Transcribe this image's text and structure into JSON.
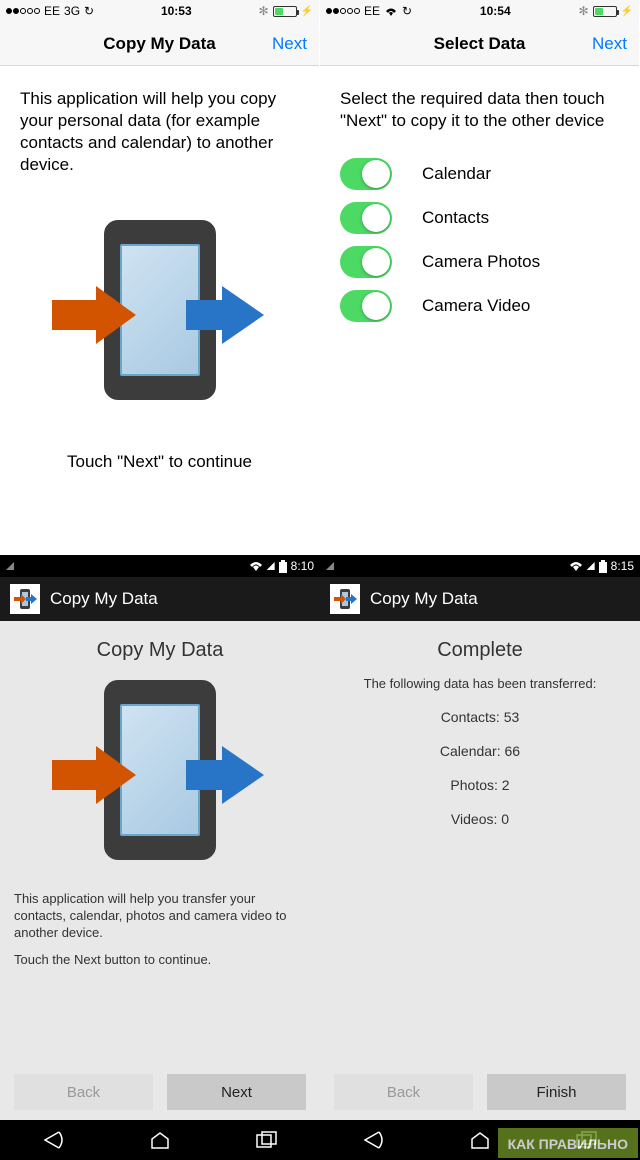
{
  "ios_left": {
    "status": {
      "carrier": "EE",
      "net": "3G",
      "time": "10:53"
    },
    "nav": {
      "title": "Copy My Data",
      "next": "Next"
    },
    "intro": "This application will help you copy your personal data (for example contacts and calendar) to another device.",
    "hint": "Touch \"Next\" to continue"
  },
  "ios_right": {
    "status": {
      "carrier": "EE",
      "time": "10:54"
    },
    "nav": {
      "title": "Select Data",
      "next": "Next"
    },
    "prompt": "Select the required data then touch \"Next\" to copy it to the other device",
    "items": [
      {
        "label": "Calendar",
        "on": true
      },
      {
        "label": "Contacts",
        "on": true
      },
      {
        "label": "Camera Photos",
        "on": true
      },
      {
        "label": "Camera Video",
        "on": true
      }
    ]
  },
  "and_left": {
    "status": {
      "time": "8:10"
    },
    "appbar": "Copy My Data",
    "heading": "Copy My Data",
    "desc1": "This application will help you transfer your contacts, calendar, photos and camera video to another device.",
    "desc2": "Touch the Next button to continue.",
    "btn_back": "Back",
    "btn_next": "Next"
  },
  "and_right": {
    "status": {
      "time": "8:15"
    },
    "appbar": "Copy My Data",
    "heading": "Complete",
    "subheading": "The following data has been transferred:",
    "results": {
      "contacts_label": "Contacts:",
      "contacts_val": "53",
      "calendar_label": "Calendar:",
      "calendar_val": "66",
      "photos_label": "Photos:",
      "photos_val": "2",
      "videos_label": "Videos:",
      "videos_val": "0"
    },
    "btn_back": "Back",
    "btn_finish": "Finish"
  },
  "watermark": "КАК ПРАВИЛЬНО",
  "icons": {
    "bluetooth": "✻",
    "bolt": "⚡",
    "refresh": "↻",
    "wifi": "▲"
  }
}
